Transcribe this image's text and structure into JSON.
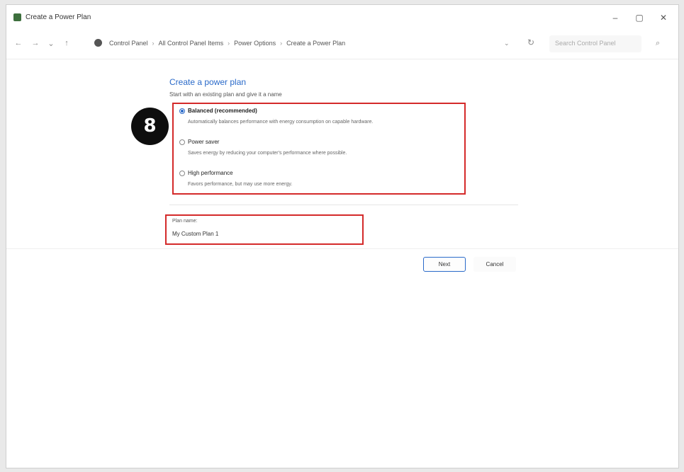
{
  "window": {
    "title": "Create a Power Plan",
    "minimize_glyph": "–",
    "maximize_glyph": "▢",
    "close_glyph": "✕"
  },
  "navigation": {
    "back_glyph": "←",
    "forward_glyph": "→",
    "history_glyph": "⌄",
    "up_glyph": "↑",
    "breadcrumbs": [
      "Control Panel",
      "All Control Panel Items",
      "Power Options",
      "Create a Power Plan"
    ],
    "separator": "›",
    "dropdown_glyph": "⌄",
    "refresh_glyph": "↻",
    "search_placeholder": "Search Control Panel",
    "search_glyph": "⌕"
  },
  "main": {
    "heading": "Create a power plan",
    "subheading": "Start with an existing plan and give it a name",
    "step_badge": "8",
    "plans": [
      {
        "name": "Balanced (recommended)",
        "description": "Automatically balances performance with energy consumption on capable hardware.",
        "selected": true
      },
      {
        "name": "Power saver",
        "description": "Saves energy by reducing your computer's performance where possible.",
        "selected": false
      },
      {
        "name": "High performance",
        "description": "Favors performance, but may use more energy.",
        "selected": false
      }
    ],
    "plan_name_label": "Plan name:",
    "plan_name_value": "My Custom Plan 1",
    "next_label": "Next",
    "cancel_label": "Cancel"
  },
  "colors": {
    "accent": "#2a6ac9",
    "highlight": "#d42a2a",
    "badge": "#0e0e0e"
  }
}
